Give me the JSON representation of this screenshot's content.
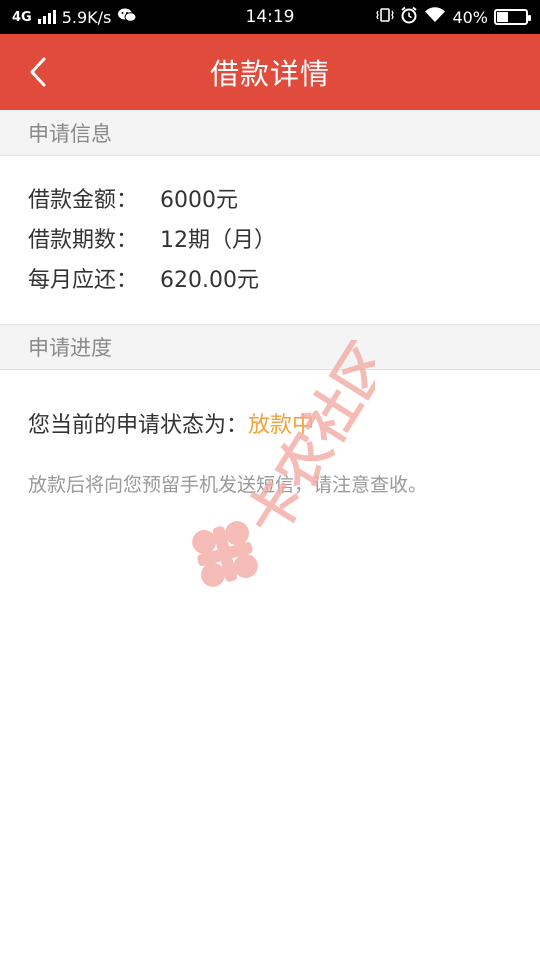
{
  "status_bar": {
    "network": "4G",
    "speed": "5.9K/s",
    "time": "14:19",
    "battery": "40%",
    "battery_level": 0.4
  },
  "header": {
    "title": "借款详情"
  },
  "application_info": {
    "section_title": "申请信息",
    "rows": [
      {
        "label": "借款金额：",
        "value": "6000元"
      },
      {
        "label": "借款期数：",
        "value": "12期（月）"
      },
      {
        "label": "每月应还：",
        "value": "620.00元"
      }
    ]
  },
  "application_progress": {
    "section_title": "申请进度",
    "status_label": "您当前的申请状态为：",
    "status_value": "放款中",
    "status_color": "#f2a23a",
    "notice": "放款后将向您预留手机发送短信，请注意查收。"
  },
  "watermark": {
    "text": "卡农社区"
  },
  "colors": {
    "header_bg": "#e04b3c",
    "section_bg": "#f4f4f4",
    "watermark": "#f2a9a2"
  }
}
